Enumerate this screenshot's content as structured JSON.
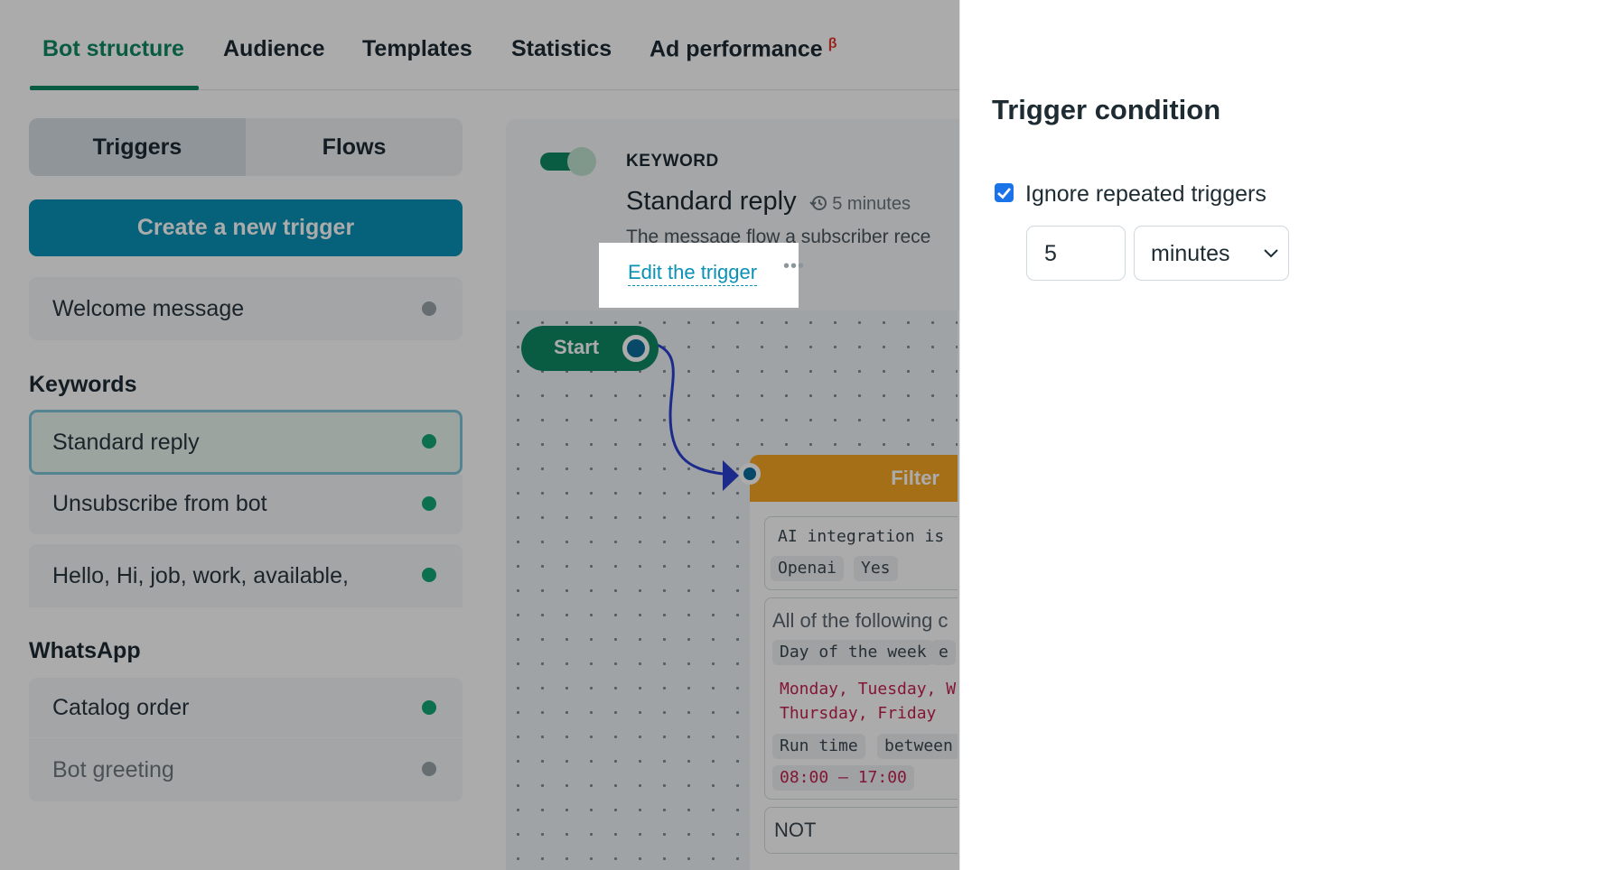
{
  "tabs": [
    {
      "label": "Bot structure",
      "active": true
    },
    {
      "label": "Audience",
      "active": false
    },
    {
      "label": "Templates",
      "active": false
    },
    {
      "label": "Statistics",
      "active": false
    },
    {
      "label": "Ad performance",
      "active": false,
      "badge": "β"
    }
  ],
  "segmented": {
    "triggers": "Triggers",
    "flows": "Flows",
    "active": "Triggers"
  },
  "create_button": "Create a new trigger",
  "default_triggers": [
    {
      "label": "Welcome message",
      "status": "inactive"
    }
  ],
  "sections": {
    "keywords": {
      "title": "Keywords",
      "items": [
        {
          "label": "Standard reply",
          "status": "active",
          "selected": true
        },
        {
          "label": "Unsubscribe from bot",
          "status": "active"
        },
        {
          "label": "Hello, Hi, job, work, available,",
          "status": "active"
        }
      ]
    },
    "whatsapp": {
      "title": "WhatsApp",
      "items": [
        {
          "label": "Catalog order",
          "status": "active"
        },
        {
          "label": "Bot greeting",
          "status": "inactive"
        }
      ]
    }
  },
  "trigger_detail": {
    "type": "KEYWORD",
    "name": "Standard reply",
    "throttle": "5 minutes",
    "description": "The message flow a subscriber rece",
    "edit_link": "Edit the trigger",
    "more": "•••"
  },
  "flow": {
    "start_label": "Start",
    "filter_title": "Filter",
    "condition1": {
      "text": "AI integration is",
      "chip1": "Openai",
      "chip2": "Yes"
    },
    "condition2": {
      "header": "All of the following c",
      "day_chip": "Day of the week",
      "day_extra": "e",
      "days_line1": "Monday, Tuesday, W",
      "days_line2": "Thursday, Friday",
      "runtime_chip": "Run time",
      "between_chip": "between",
      "time_range": "08:00 — 17:00"
    },
    "not_label": "NOT"
  },
  "panel": {
    "title": "Trigger condition",
    "checkbox_label": "Ignore repeated triggers",
    "checkbox_checked": true,
    "interval_value": "5",
    "interval_unit": "minutes",
    "unit_options": [
      "minutes"
    ]
  },
  "colors": {
    "brand_green": "#0e8a63",
    "accent_blue": "#0a91b6",
    "filter_orange": "#f5a623",
    "connector_blue": "#2b3fd1"
  }
}
